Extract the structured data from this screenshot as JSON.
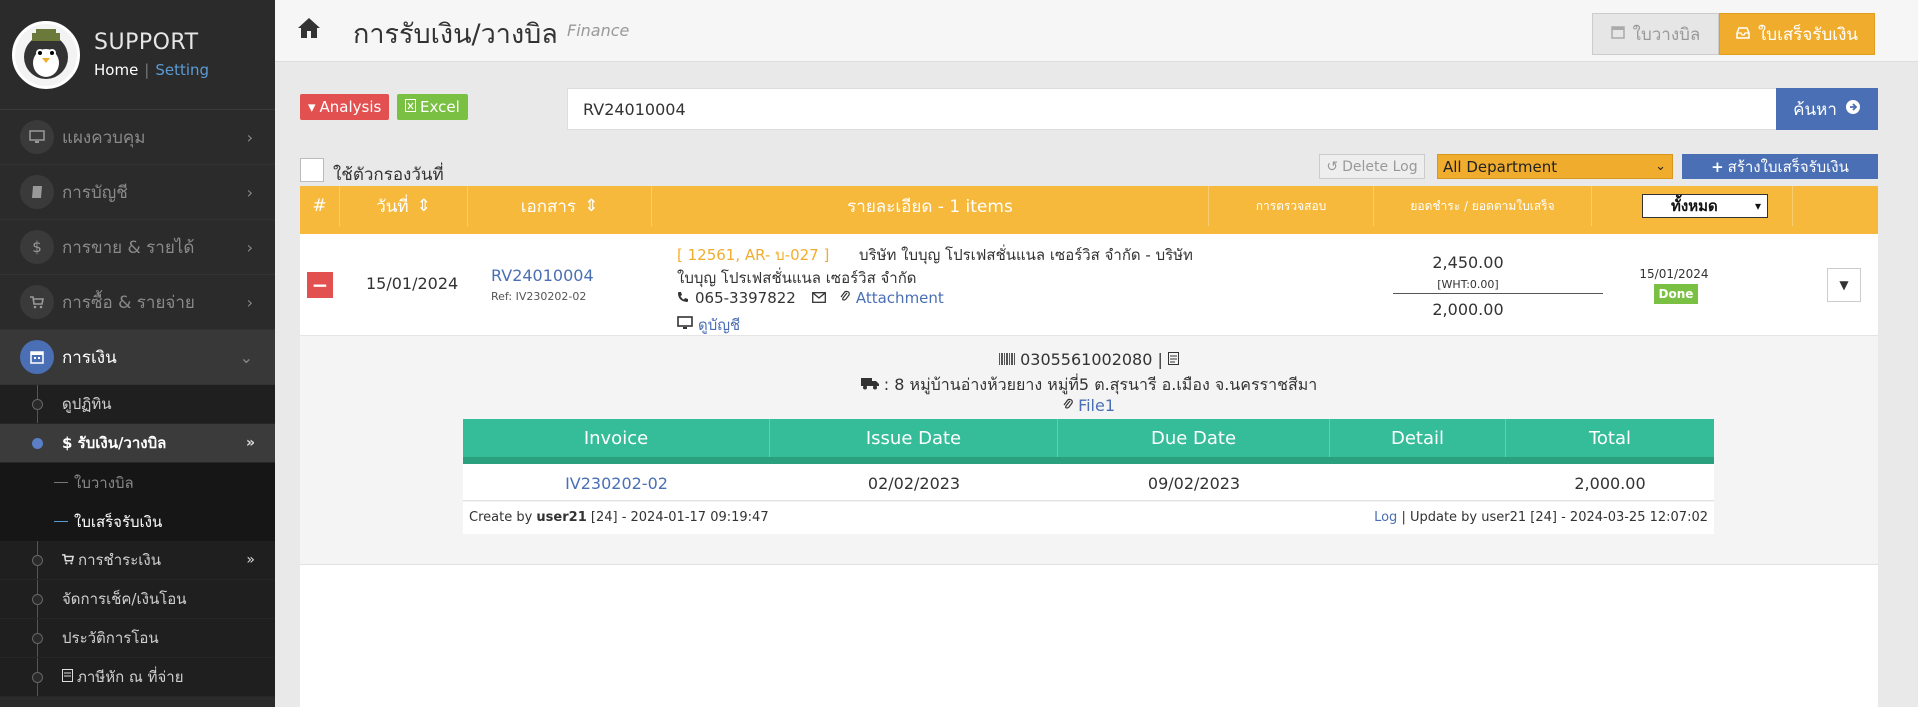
{
  "sidebar": {
    "brand_title": "SUPPORT",
    "home_link": "Home",
    "separator": "|",
    "setting_link": "Setting",
    "menu": [
      {
        "label": "แผงควบคุม",
        "icon": "monitor-icon"
      },
      {
        "label": "การบัญชี",
        "icon": "book-icon"
      },
      {
        "label": "การขาย & รายได้",
        "icon": "dollar-icon"
      },
      {
        "label": "การซื้อ & รายจ่าย",
        "icon": "cart-icon"
      },
      {
        "label": "การเงิน",
        "icon": "calendar-icon",
        "active": true
      }
    ],
    "finance_sub": [
      {
        "label": "ดูปฏิทิน"
      },
      {
        "label": "$ รับเงิน/วางบิล",
        "active": true
      },
      {
        "label": "การชำระเงิน"
      },
      {
        "label": "จัดการเช็ค/เงินโอน"
      },
      {
        "label": "ประวัติการโอน"
      },
      {
        "label": "ภาษีหัก ณ ที่จ่าย"
      }
    ],
    "receive_sub": [
      {
        "label": "ใบวางบิล"
      },
      {
        "label": "ใบเสร็จรับเงิน",
        "active": true
      }
    ]
  },
  "header": {
    "title": "การรับเงิน/วางบิล",
    "subtitle": "Finance",
    "btn_bill": "ใบวางบิล",
    "btn_receipt": "ใบเสร็จรับเงิน"
  },
  "toolbar": {
    "analysis": "Analysis",
    "excel": "Excel",
    "search_value": "RV24010004",
    "search_button": "ค้นหา",
    "filter_label": "ใช้ตัวกรองวันที่",
    "delete_log": "Delete Log",
    "department": "All Department",
    "create_button": "สร้างใบเสร็จรับเงิน"
  },
  "table": {
    "headers": {
      "num": "#",
      "date": "วันที่",
      "doc": "เอกสาร",
      "detail": "รายละเอียด - 1 items",
      "check": "การตรวจสอบ",
      "amount": "ยอดชำระ / ยอดตามใบเสร็จ",
      "status_filter": "ทั้งหมด"
    },
    "row": {
      "date": "15/01/2024",
      "doc_no": "RV24010004",
      "ref": "Ref: IV230202-02",
      "customer_code": "[ 12561, AR- บ-027 ]",
      "customer_name_1": "บริษัท ใบบุญ โปรเฟสชั่นแนล เซอร์วิส จำกัด - บริษัท",
      "customer_name_2": "ใบบุญ โปรเฟสชั่นแนล เซอร์วิส จำกัด",
      "phone": "065-3397822",
      "attachment": "Attachment",
      "ledger": "ดูบัญชี",
      "amount_paid": "2,450.00",
      "wht": "[WHT:0.00]",
      "amount_receipt": "2,000.00",
      "check_date": "15/01/2024",
      "status": "Done"
    }
  },
  "detail": {
    "tax_id": "0305561002080",
    "address": ": 8 หมู่บ้านอ่างห้วยยาง หมู่ที่5 ต.สุรนารี อ.เมือง จ.นครราชสีมา",
    "file": "File1",
    "invoice_headers": {
      "invoice": "Invoice",
      "issue_date": "Issue Date",
      "due_date": "Due Date",
      "detail": "Detail",
      "total": "Total"
    },
    "invoice_row": {
      "invoice": "IV230202-02",
      "issue_date": "02/02/2023",
      "due_date": "09/02/2023",
      "detail": "",
      "total": "2,000.00"
    },
    "create_prefix": "Create by",
    "create_user": "user21",
    "create_rest": "[24] - 2024-01-17 09:19:47",
    "log": "Log",
    "update_text": "| Update by user21 [24] - 2024-03-25 12:07:02"
  },
  "colors": {
    "sidebar_bg": "#2b2b2b",
    "accent_orange": "#f0ad2d",
    "accent_blue": "#4a6fb5",
    "danger_red": "#e25050",
    "success_green": "#7ac143",
    "teal": "#35bd9a"
  }
}
